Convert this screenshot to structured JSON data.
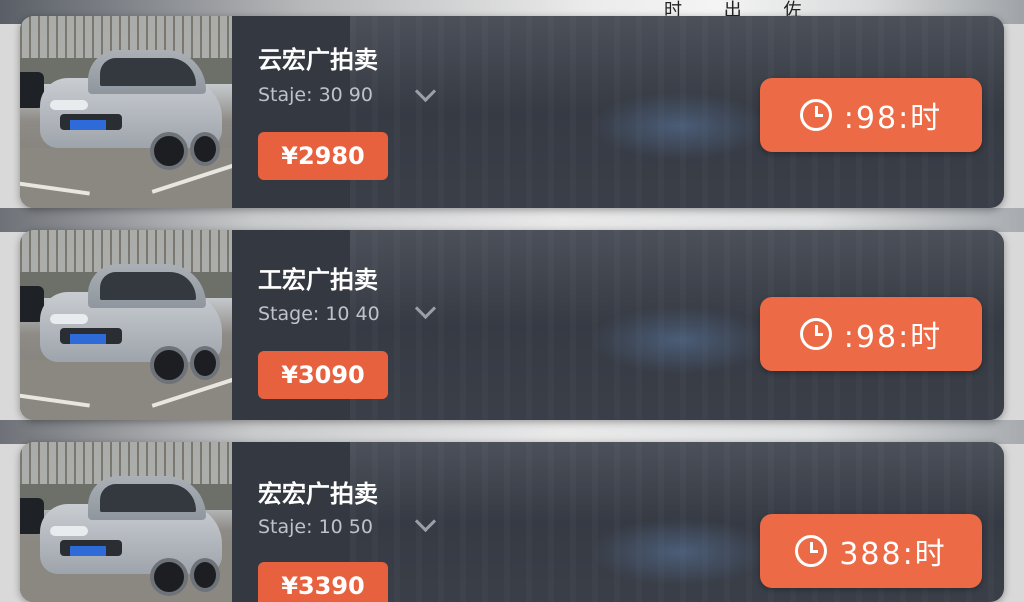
{
  "header": {
    "partial_text": "时 出 佐"
  },
  "listings": [
    {
      "title": "云宏广拍卖",
      "stage": "Staje:  30 90",
      "price": "¥2980",
      "timer": ":98:时"
    },
    {
      "title": "工宏广拍卖",
      "stage": "Stage:  10 40",
      "price": "¥3090",
      "timer": ":98:时"
    },
    {
      "title": "宏宏广拍卖",
      "stage": "Staje:  10 50",
      "price": "¥3390",
      "timer": "388:时"
    }
  ],
  "icons": {
    "expand": "chevron-down-icon",
    "timer": "clock-icon"
  },
  "colors": {
    "card": "#343841",
    "accent": "#ec6a45",
    "price_bg": "#e8613f"
  }
}
